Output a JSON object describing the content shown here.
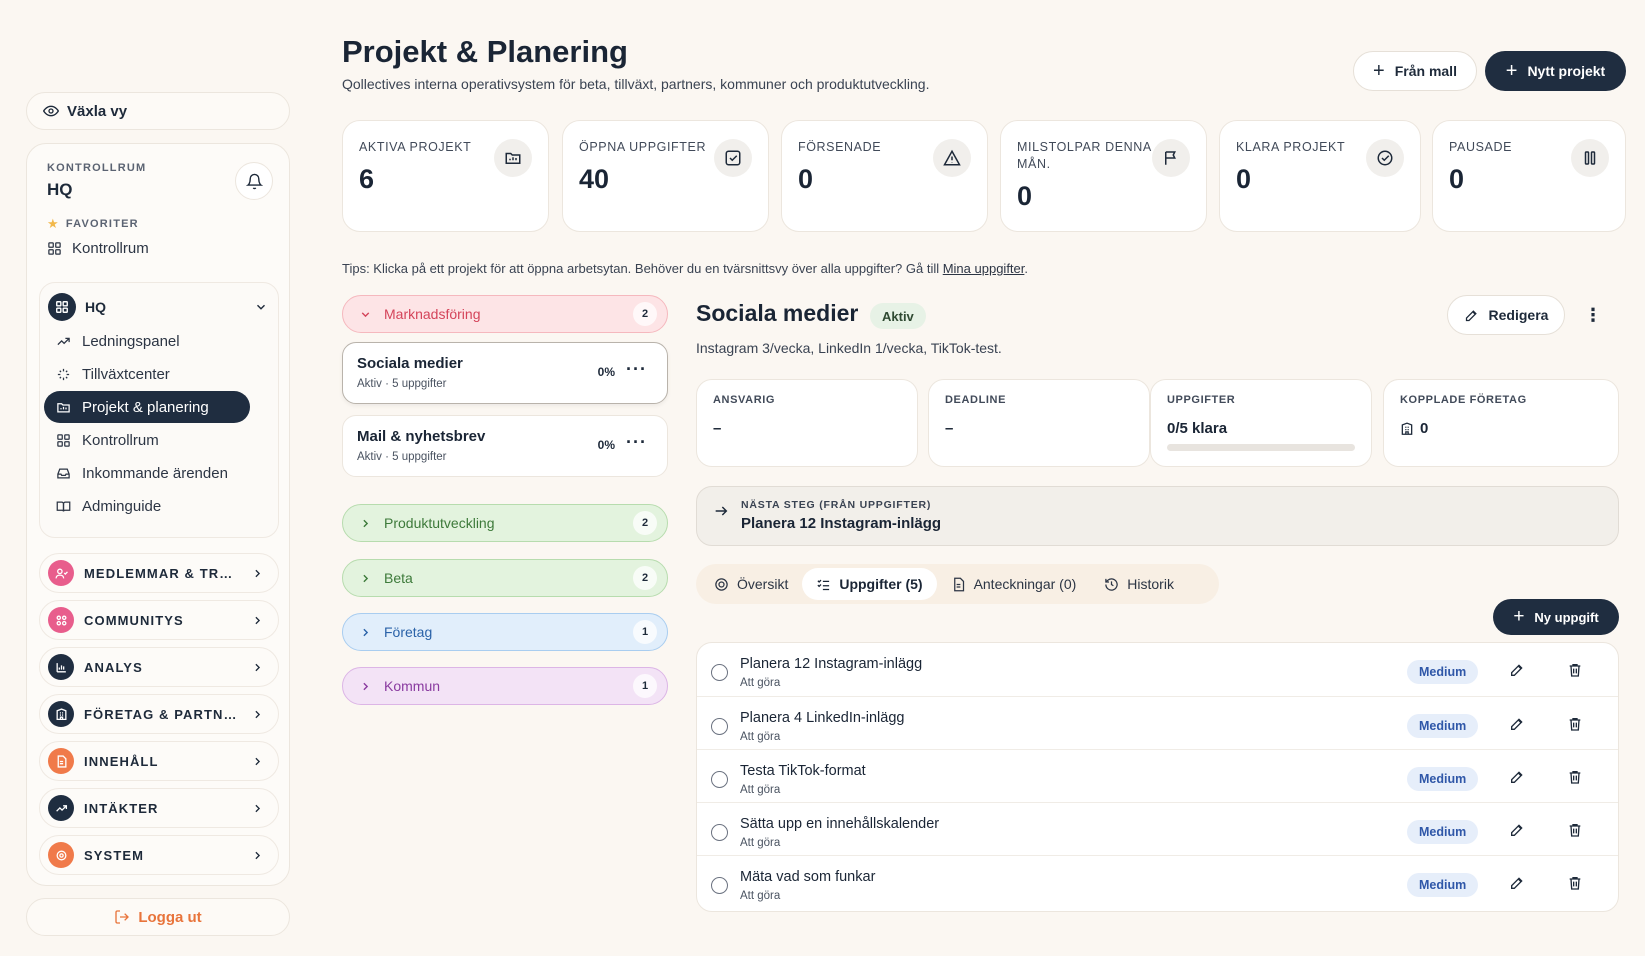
{
  "sidebar": {
    "switch_view": "Växla vy",
    "kicker": "KONTROLLRUM",
    "title": "HQ",
    "favorites_label": "FAVORITER",
    "favorites": [
      {
        "label": "Kontrollrum",
        "icon": "grid-icon"
      }
    ],
    "hq_group": {
      "label": "HQ",
      "items": [
        {
          "label": "Ledningspanel",
          "icon": "trend-icon"
        },
        {
          "label": "Tillväxtcenter",
          "icon": "sparkle-icon"
        },
        {
          "label": "Projekt & planering",
          "icon": "folder-icon",
          "active": true
        },
        {
          "label": "Kontrollrum",
          "icon": "grid-icon"
        },
        {
          "label": "Inkommande ärenden",
          "icon": "inbox-icon"
        },
        {
          "label": "Adminguide",
          "icon": "book-icon"
        }
      ]
    },
    "categories": [
      {
        "label": "MEDLEMMAR & TRUST",
        "icon": "users-icon",
        "color": "#e85d8c"
      },
      {
        "label": "COMMUNITYS",
        "icon": "community-icon",
        "color": "#e85d8c"
      },
      {
        "label": "ANALYS",
        "icon": "chart-icon",
        "color": "#1f2d40"
      },
      {
        "label": "FÖRETAG & PARTNERS",
        "icon": "building-icon",
        "color": "#1f2d40"
      },
      {
        "label": "INNEHÅLL",
        "icon": "document-icon",
        "color": "#f07a4a"
      },
      {
        "label": "INTÄKTER",
        "icon": "revenue-icon",
        "color": "#1f2d40"
      },
      {
        "label": "SYSTEM",
        "icon": "system-icon",
        "color": "#f07a4a"
      }
    ],
    "logout": "Logga ut"
  },
  "header": {
    "title": "Projekt & Planering",
    "subtitle": "Qollectives interna operativsystem för beta, tillväxt, partners, kommuner och produktutveckling.",
    "template_button": "Från mall",
    "new_button": "Nytt projekt"
  },
  "stats": [
    {
      "label": "AKTIVA PROJEKT",
      "value": "6",
      "icon": "folder-chart-icon"
    },
    {
      "label": "ÖPPNA UPPGIFTER",
      "value": "40",
      "icon": "checkbox-icon"
    },
    {
      "label": "FÖRSENADE",
      "value": "0",
      "icon": "warning-icon"
    },
    {
      "label": "MILSTOLPAR DENNA MÅN.",
      "value": "0",
      "icon": "flag-icon"
    },
    {
      "label": "KLARA PROJEKT",
      "value": "0",
      "icon": "check-circle-icon"
    },
    {
      "label": "PAUSADE",
      "value": "0",
      "icon": "pause-icon"
    }
  ],
  "tips": {
    "text": "Tips: Klicka på ett projekt för att öppna arbetsytan. Behöver du en tvärsnittsvy över alla uppgifter? Gå till ",
    "link": "Mina uppgifter",
    "suffix": "."
  },
  "groups": [
    {
      "label": "Marknadsföring",
      "count": "2",
      "expanded": true,
      "bg": "#fde4e6",
      "border": "#f5b8be",
      "fg": "#d4445a"
    },
    {
      "label": "Produktutveckling",
      "count": "2",
      "bg": "#e3f3de",
      "border": "#b7dcae",
      "fg": "#3d7a3a"
    },
    {
      "label": "Beta",
      "count": "2",
      "bg": "#e3f3de",
      "border": "#b7dcae",
      "fg": "#3d7a3a"
    },
    {
      "label": "Företag",
      "count": "1",
      "bg": "#e1eefb",
      "border": "#a9cdf0",
      "fg": "#2a62a8"
    },
    {
      "label": "Kommun",
      "count": "1",
      "bg": "#f3e3f6",
      "border": "#dcb5e6",
      "fg": "#8a3ba0"
    }
  ],
  "projects": [
    {
      "name": "Sociala medier",
      "meta": "Aktiv · 5 uppgifter",
      "progress": "0%",
      "selected": true
    },
    {
      "name": "Mail & nyhetsbrev",
      "meta": "Aktiv · 5 uppgifter",
      "progress": "0%"
    }
  ],
  "detail": {
    "title": "Sociala medier",
    "status": "Aktiv",
    "description": "Instagram 3/vecka, LinkedIn 1/vecka, TikTok-test.",
    "edit_button": "Redigera",
    "more": "⋮",
    "info": [
      {
        "label": "ANSVARIG",
        "value": "–"
      },
      {
        "label": "DEADLINE",
        "value": "–"
      },
      {
        "label": "UPPGIFTER",
        "value": "0/5 klara",
        "progress": 0
      },
      {
        "label": "KOPPLADE FÖRETAG",
        "value": "0",
        "icon": "building-icon"
      }
    ],
    "next_step": {
      "label": "NÄSTA STEG (FRÅN UPPGIFTER)",
      "value": "Planera 12 Instagram-inlägg"
    },
    "tabs": [
      {
        "label": "Översikt",
        "icon": "target-icon"
      },
      {
        "label": "Uppgifter (5)",
        "icon": "list-check-icon",
        "active": true
      },
      {
        "label": "Anteckningar (0)",
        "icon": "note-icon"
      },
      {
        "label": "Historik",
        "icon": "history-icon"
      }
    ],
    "new_task_button": "Ny uppgift",
    "tasks": [
      {
        "name": "Planera 12 Instagram-inlägg",
        "status": "Att göra",
        "priority": "Medium"
      },
      {
        "name": "Planera 4 LinkedIn-inlägg",
        "status": "Att göra",
        "priority": "Medium"
      },
      {
        "name": "Testa TikTok-format",
        "status": "Att göra",
        "priority": "Medium"
      },
      {
        "name": "Sätta upp en innehållskalender",
        "status": "Att göra",
        "priority": "Medium"
      },
      {
        "name": "Mäta vad som funkar",
        "status": "Att göra",
        "priority": "Medium"
      }
    ]
  }
}
